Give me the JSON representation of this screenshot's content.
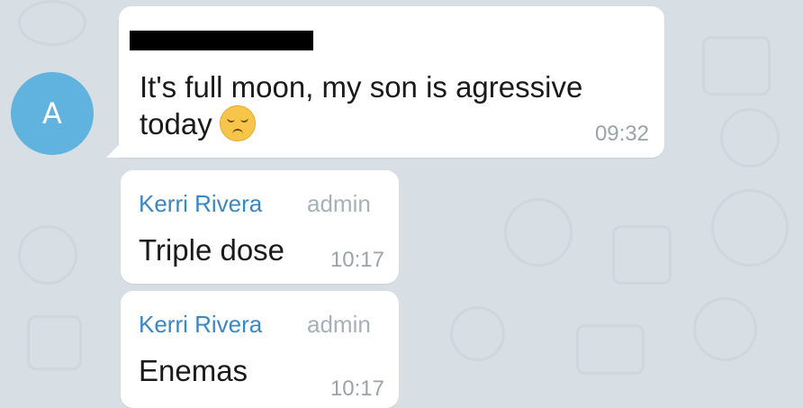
{
  "chat": {
    "messages": [
      {
        "avatar_letter": "A",
        "text": "It's full moon,  my son is agressive today",
        "emoji": "pensive-face",
        "time": "09:32"
      },
      {
        "sender": "Kerri Rivera",
        "role": "admin",
        "text": "Triple dose",
        "time": "10:17"
      },
      {
        "sender": "Kerri Rivera",
        "role": "admin",
        "text": "Enemas",
        "time": "10:17"
      }
    ]
  },
  "colors": {
    "background": "#d7dfe5",
    "avatar": "#60b3de",
    "sender_name": "#3b87c3",
    "timestamp": "#9aa3ab"
  }
}
